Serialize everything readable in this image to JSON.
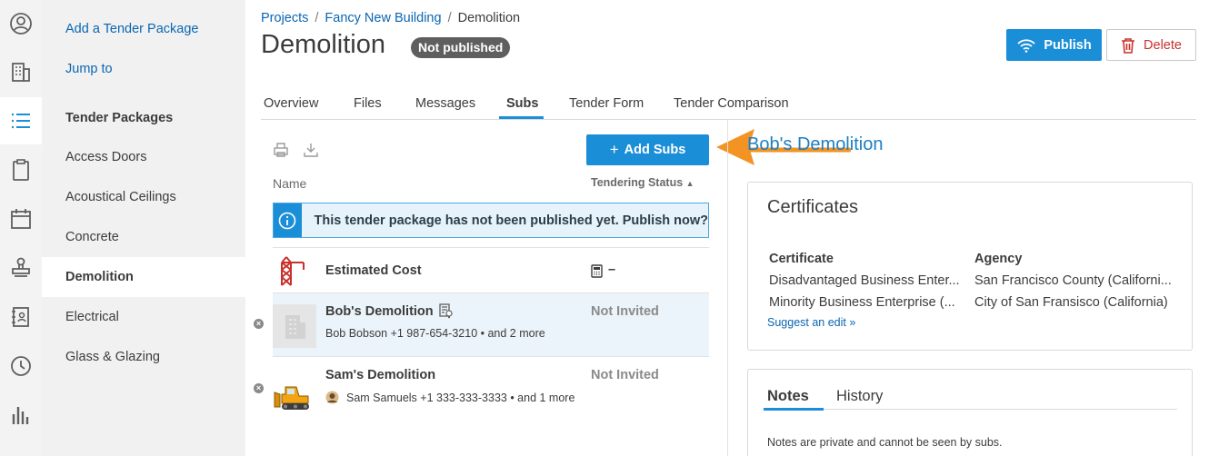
{
  "rail": {
    "icons": [
      "user-icon",
      "building-icon",
      "list-icon",
      "clipboard-icon",
      "calendar-icon",
      "stamp-icon",
      "address-book-icon",
      "clock-icon",
      "bar-chart-icon"
    ]
  },
  "sidebar": {
    "add_package": "Add a Tender Package",
    "jump_to": "Jump to",
    "section_title": "Tender Packages",
    "items": [
      {
        "label": "Access Doors"
      },
      {
        "label": "Acoustical Ceilings"
      },
      {
        "label": "Concrete"
      },
      {
        "label": "Demolition"
      },
      {
        "label": "Electrical"
      },
      {
        "label": "Glass & Glazing"
      }
    ]
  },
  "header": {
    "breadcrumb": [
      "Projects",
      "Fancy New Building",
      "Demolition"
    ],
    "title": "Demolition",
    "status_badge": "Not published",
    "publish_label": "Publish",
    "delete_label": "Delete"
  },
  "tabs": [
    {
      "label": "Overview"
    },
    {
      "label": "Files"
    },
    {
      "label": "Messages"
    },
    {
      "label": "Subs"
    },
    {
      "label": "Tender Form"
    },
    {
      "label": "Tender Comparison"
    }
  ],
  "active_tab": "Subs",
  "subs": {
    "add_label": "Add Subs",
    "col_name": "Name",
    "col_status": "Tendering Status",
    "banner_text": "This tender package has not been published yet. Publish now?",
    "estimated_cost_label": "Estimated Cost",
    "estimated_cost_value": "–",
    "rows": [
      {
        "name": "Bob's Demolition",
        "contact": "Bob Bobson +1 987-654-3210 • and 2 more",
        "status": "Not Invited"
      },
      {
        "name": "Sam's Demolition",
        "contact": "Sam Samuels +1 333-333-3333 • and 1 more",
        "status": "Not Invited"
      }
    ]
  },
  "detail": {
    "title": "Bob's Demolition",
    "certificates": {
      "title": "Certificates",
      "col_certificate": "Certificate",
      "col_agency": "Agency",
      "rows": [
        {
          "certificate": "Disadvantaged Business Enter...",
          "agency": "San Francisco County (Californi..."
        },
        {
          "certificate": "Minority Business Enterprise (...",
          "agency": "City of San Fransisco (California)"
        }
      ],
      "suggest_edit": "Suggest an edit »"
    },
    "notes": {
      "tab_notes": "Notes",
      "tab_history": "History",
      "text": "Notes are private and cannot be seen by subs."
    }
  },
  "colors": {
    "accent": "#1b8ed8",
    "link": "#0b66b2",
    "danger": "#c8322b",
    "annotation_arrow": "#f39324"
  }
}
